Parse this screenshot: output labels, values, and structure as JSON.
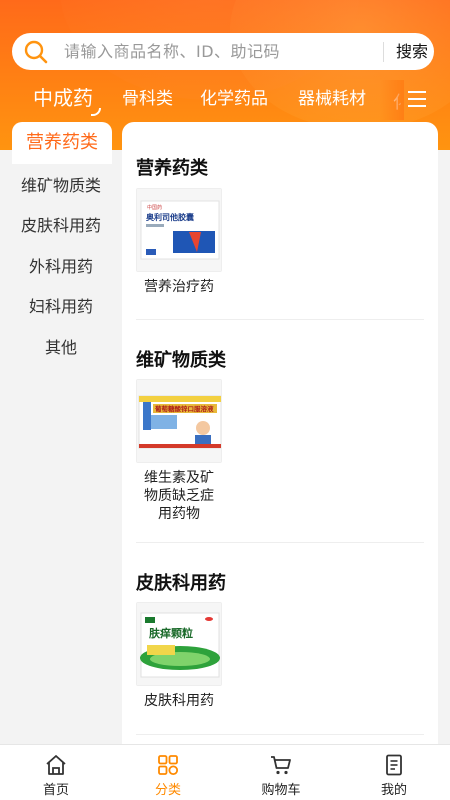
{
  "search": {
    "placeholder": "请输入商品名称、ID、助记码",
    "button_label": "搜索"
  },
  "top_tabs": [
    {
      "label": "中成药",
      "active": true
    },
    {
      "label": "骨科类"
    },
    {
      "label": "化学药品"
    },
    {
      "label": "器械耗材"
    }
  ],
  "top_tab_partial": "化",
  "sidebar": {
    "items": [
      {
        "label": "营养药类",
        "active": true
      },
      {
        "label": "维矿物质类"
      },
      {
        "label": "皮肤科用药"
      },
      {
        "label": "外科用药"
      },
      {
        "label": "妇科用药"
      },
      {
        "label": "其他"
      }
    ]
  },
  "sections": [
    {
      "title": "营养药类",
      "products": [
        {
          "label": "营养治疗药",
          "image": {
            "brand": "奥利司他胶囊",
            "tag": "中国药"
          }
        }
      ]
    },
    {
      "title": "维矿物质类",
      "products": [
        {
          "label": "维生素及矿物质缺乏症用药物",
          "label_lines": [
            "维生素及矿",
            "物质缺乏症",
            "用药物"
          ],
          "image": {
            "brand": "葡萄糖酸锌口服溶液"
          }
        }
      ]
    },
    {
      "title": "皮肤科用药",
      "products": [
        {
          "label": "皮肤科用药",
          "image": {
            "brand": "肤痒颗粒"
          }
        }
      ]
    }
  ],
  "bottom_nav": [
    {
      "label": "首页",
      "icon": "home-icon"
    },
    {
      "label": "分类",
      "icon": "category-icon",
      "active": true
    },
    {
      "label": "购物车",
      "icon": "cart-icon"
    },
    {
      "label": "我的",
      "icon": "profile-icon"
    }
  ],
  "colors": {
    "accent": "#ff6a1a",
    "nav_active": "#ff8a00"
  }
}
